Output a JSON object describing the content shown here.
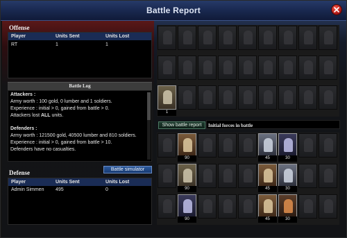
{
  "window": {
    "title": "Battle Report"
  },
  "offense": {
    "title": "Offense",
    "columns": [
      "Player",
      "Units Sent",
      "Units Lost"
    ],
    "rows": [
      {
        "player": "RT",
        "sent": "1",
        "lost": "1"
      }
    ]
  },
  "battle_log": {
    "title": "Battle Log",
    "attackers_heading": "Attackers :",
    "attackers_worth": "Army worth : 100 gold, 0 lumber and 1 soldiers.",
    "attackers_exp": "Experience : initial > 0, gained from battle > 0.",
    "attackers_lost_prefix": "Attackers lost ",
    "attackers_lost_bold": "ALL",
    "attackers_lost_suffix": " units.",
    "defenders_heading": "Defenders :",
    "defenders_worth": "Army worth : 121500 gold, 40500 lumber and 810 soldiers.",
    "defenders_exp": "Experience : initial > 0, gained from battle > 10.",
    "defenders_casualties": "Defenders have no casualties."
  },
  "defense": {
    "title": "Defense",
    "simulator_label": "Battle simulator",
    "columns": [
      "Player",
      "Units Sent",
      "Units Lost"
    ],
    "rows": [
      {
        "player": "Admin Simmen",
        "sent": "495",
        "lost": "0"
      }
    ]
  },
  "right": {
    "show_report_label": "Show battle report",
    "initial_forces_label": "Initial forces in battle",
    "attacker_unit_count": "1",
    "defender_counts": {
      "r1": [
        "90",
        "45",
        "30"
      ],
      "r2": [
        "90",
        "45",
        "30"
      ],
      "r3": [
        "90",
        "45",
        "30"
      ]
    }
  }
}
